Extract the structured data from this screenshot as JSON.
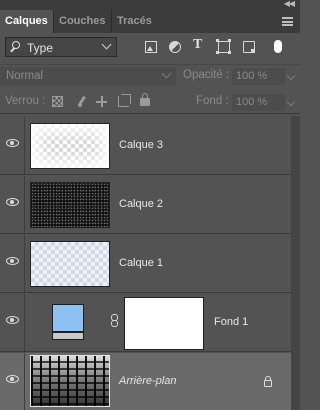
{
  "tabs": [
    {
      "label": "Calques",
      "active": true
    },
    {
      "label": "Couches",
      "active": false
    },
    {
      "label": "Tracés",
      "active": false
    }
  ],
  "filter": {
    "kind_label": "Type",
    "icons": [
      "image-filter-icon",
      "adjustment-filter-icon",
      "type-filter-icon",
      "shape-filter-icon",
      "smart-object-filter-icon"
    ]
  },
  "blend": {
    "mode": "Normal",
    "opacity_label": "Opacité :",
    "opacity_value": "100 %"
  },
  "lock": {
    "label": "Verrou :",
    "fill_label": "Fond :",
    "fill_value": "100 %"
  },
  "layers": [
    {
      "name": "Calque 3",
      "visible": true,
      "selected": false,
      "thumbnail": "cloud-on-transparent"
    },
    {
      "name": "Calque 2",
      "visible": true,
      "selected": false,
      "thumbnail": "noise-dark"
    },
    {
      "name": "Calque 1",
      "visible": true,
      "selected": false,
      "thumbnail": "light-blue-transparent"
    },
    {
      "name": "Fond 1",
      "visible": true,
      "selected": false,
      "thumbnail": "solid-color-fill",
      "fill_color": "#8fc0f2",
      "has_mask": true
    },
    {
      "name": "Arrière-plan",
      "visible": true,
      "selected": true,
      "thumbnail": "street-photo-sketch",
      "locked": true
    }
  ],
  "colors": {
    "panel_bg": "#535353",
    "tab_bar_bg": "#3c3c3c",
    "selected_layer_bg": "#6a6a6a",
    "fill_swatch": "#8fc0f2"
  }
}
